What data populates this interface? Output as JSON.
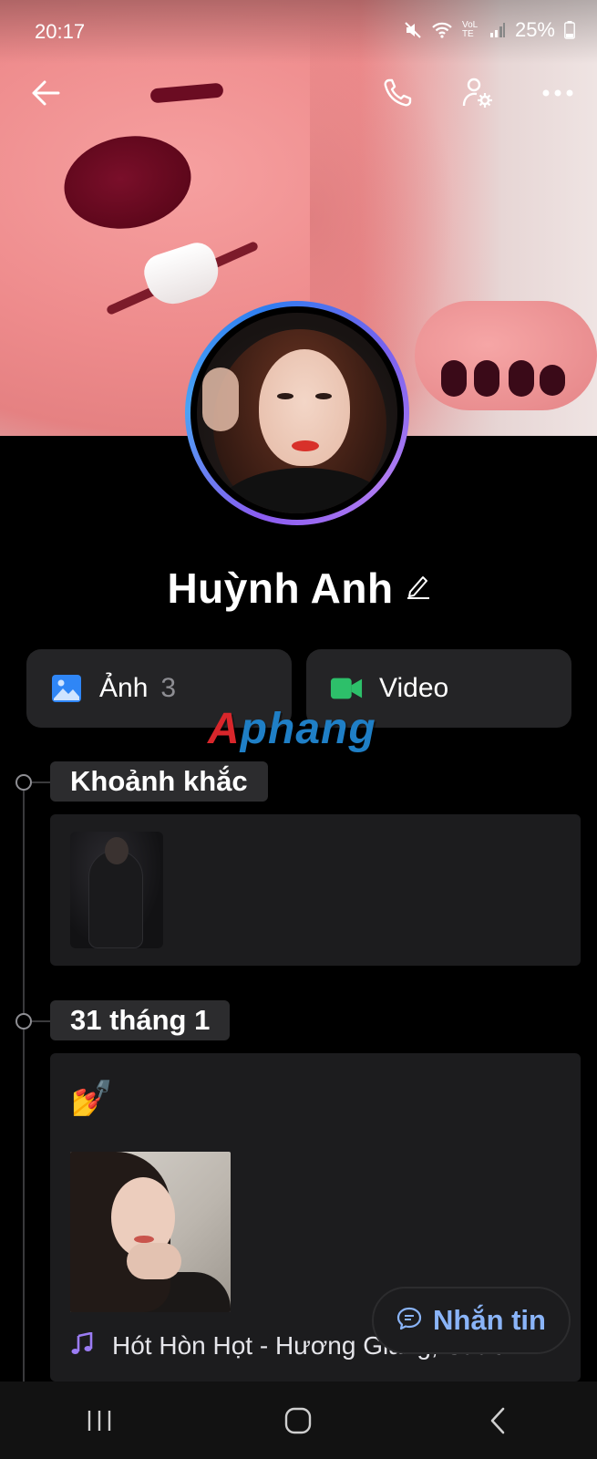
{
  "status_bar": {
    "time": "20:17",
    "battery": "25%",
    "network": "VoLTE",
    "icons": [
      "mute-icon",
      "wifi-icon",
      "signal-icon",
      "battery-icon"
    ]
  },
  "top_bar": {
    "icons": [
      "back-arrow-icon",
      "phone-icon",
      "profile-settings-icon",
      "more-icon"
    ]
  },
  "profile": {
    "name": "Huỳnh Anh"
  },
  "media_tiles": [
    {
      "label": "Ảnh",
      "count": "3",
      "icon": "photo-icon",
      "accent": "#2f86f6"
    },
    {
      "label": "Video",
      "icon": "video-icon",
      "accent": "#2dc06a"
    }
  ],
  "watermark": {
    "accent_part": "A",
    "rest": "phang"
  },
  "timeline": {
    "sections": [
      {
        "label": "Khoảnh khắc"
      },
      {
        "label": "31 tháng 1",
        "emoji": "💅",
        "song": "Hót Hòn Họt - Hương Giang, Saabir..."
      }
    ]
  },
  "fab": {
    "label": "Nhắn tin",
    "icon": "chat-icon"
  },
  "nav_bar": {
    "icons": [
      "recent-apps-icon",
      "home-icon",
      "nav-back-icon"
    ]
  },
  "colors": {
    "background": "#000000",
    "card": "#1c1c1e",
    "tile": "#242426",
    "fab_text": "#8ab4f8",
    "music_icon": "#9b7cf4"
  }
}
